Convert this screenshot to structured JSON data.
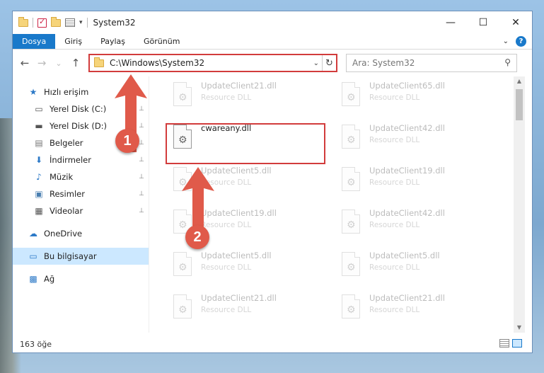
{
  "window": {
    "title": "System32",
    "controls": {
      "minimize": "—",
      "maximize": "☐",
      "close": "✕"
    }
  },
  "ribbon": {
    "tabs": [
      "Dosya",
      "Giriş",
      "Paylaş",
      "Görünüm"
    ],
    "help_label": "?"
  },
  "nav": {
    "back": "←",
    "forward": "→",
    "recent": "⌄",
    "up": "↑",
    "address": "C:\\Windows\\System32",
    "refresh": "↻",
    "search_placeholder": "Ara: System32"
  },
  "sidebar": {
    "items": [
      {
        "label": "Hızlı erişim",
        "icon": "star-icon",
        "glyph": "★",
        "color": "#2c79c7",
        "pinned": false
      },
      {
        "label": "Yerel Disk (C:)",
        "icon": "drive-icon",
        "glyph": "▭",
        "color": "#555",
        "pinned": true
      },
      {
        "label": "Yerel Disk (D:)",
        "icon": "drive-icon",
        "glyph": "▬",
        "color": "#555",
        "pinned": true
      },
      {
        "label": "Belgeler",
        "icon": "documents-icon",
        "glyph": "▤",
        "color": "#777",
        "pinned": true
      },
      {
        "label": "İndirmeler",
        "icon": "download-icon",
        "glyph": "⬇",
        "color": "#2c79c7",
        "pinned": true
      },
      {
        "label": "Müzik",
        "icon": "music-icon",
        "glyph": "♪",
        "color": "#2c79c7",
        "pinned": true
      },
      {
        "label": "Resimler",
        "icon": "pictures-icon",
        "glyph": "▣",
        "color": "#4a7fb0",
        "pinned": true
      },
      {
        "label": "Videolar",
        "icon": "video-icon",
        "glyph": "▦",
        "color": "#555",
        "pinned": true
      },
      {
        "label": "OneDrive",
        "icon": "cloud-icon",
        "glyph": "☁",
        "color": "#2c79c7",
        "pinned": false
      },
      {
        "label": "Bu bilgisayar",
        "icon": "computer-icon",
        "glyph": "▭",
        "color": "#2c79c7",
        "pinned": false
      },
      {
        "label": "Ağ",
        "icon": "network-icon",
        "glyph": "▩",
        "color": "#2c79c7",
        "pinned": false
      }
    ],
    "pin_glyph": "📌"
  },
  "files": {
    "left_column": [
      {
        "name": "UpdateClient21.dll",
        "type": "Resource DLL",
        "faded": true
      },
      {
        "name": "cwareany.dll",
        "type": "",
        "faded": false
      },
      {
        "name": "UpdateClient5.dll",
        "type": "Resource DLL",
        "faded": true
      },
      {
        "name": "UpdateClient19.dll",
        "type": "Resource DLL",
        "faded": true
      },
      {
        "name": "UpdateClient5.dll",
        "type": "Resource DLL",
        "faded": true
      },
      {
        "name": "UpdateClient21.dll",
        "type": "Resource DLL",
        "faded": true
      }
    ],
    "right_column": [
      {
        "name": "UpdateClient65.dll",
        "type": "Resource DLL",
        "faded": true
      },
      {
        "name": "UpdateClient42.dll",
        "type": "Resource DLL",
        "faded": true
      },
      {
        "name": "UpdateClient19.dll",
        "type": "Resource DLL",
        "faded": true
      },
      {
        "name": "UpdateClient42.dll",
        "type": "Resource DLL",
        "faded": true
      },
      {
        "name": "UpdateClient5.dll",
        "type": "Resource DLL",
        "faded": true
      },
      {
        "name": "UpdateClient21.dll",
        "type": "Resource DLL",
        "faded": true
      }
    ]
  },
  "status": {
    "count": "163 öğe"
  },
  "annotations": {
    "step1": "1",
    "step2": "2",
    "color": "#e05a4a",
    "highlight_color": "#d23c3c"
  }
}
